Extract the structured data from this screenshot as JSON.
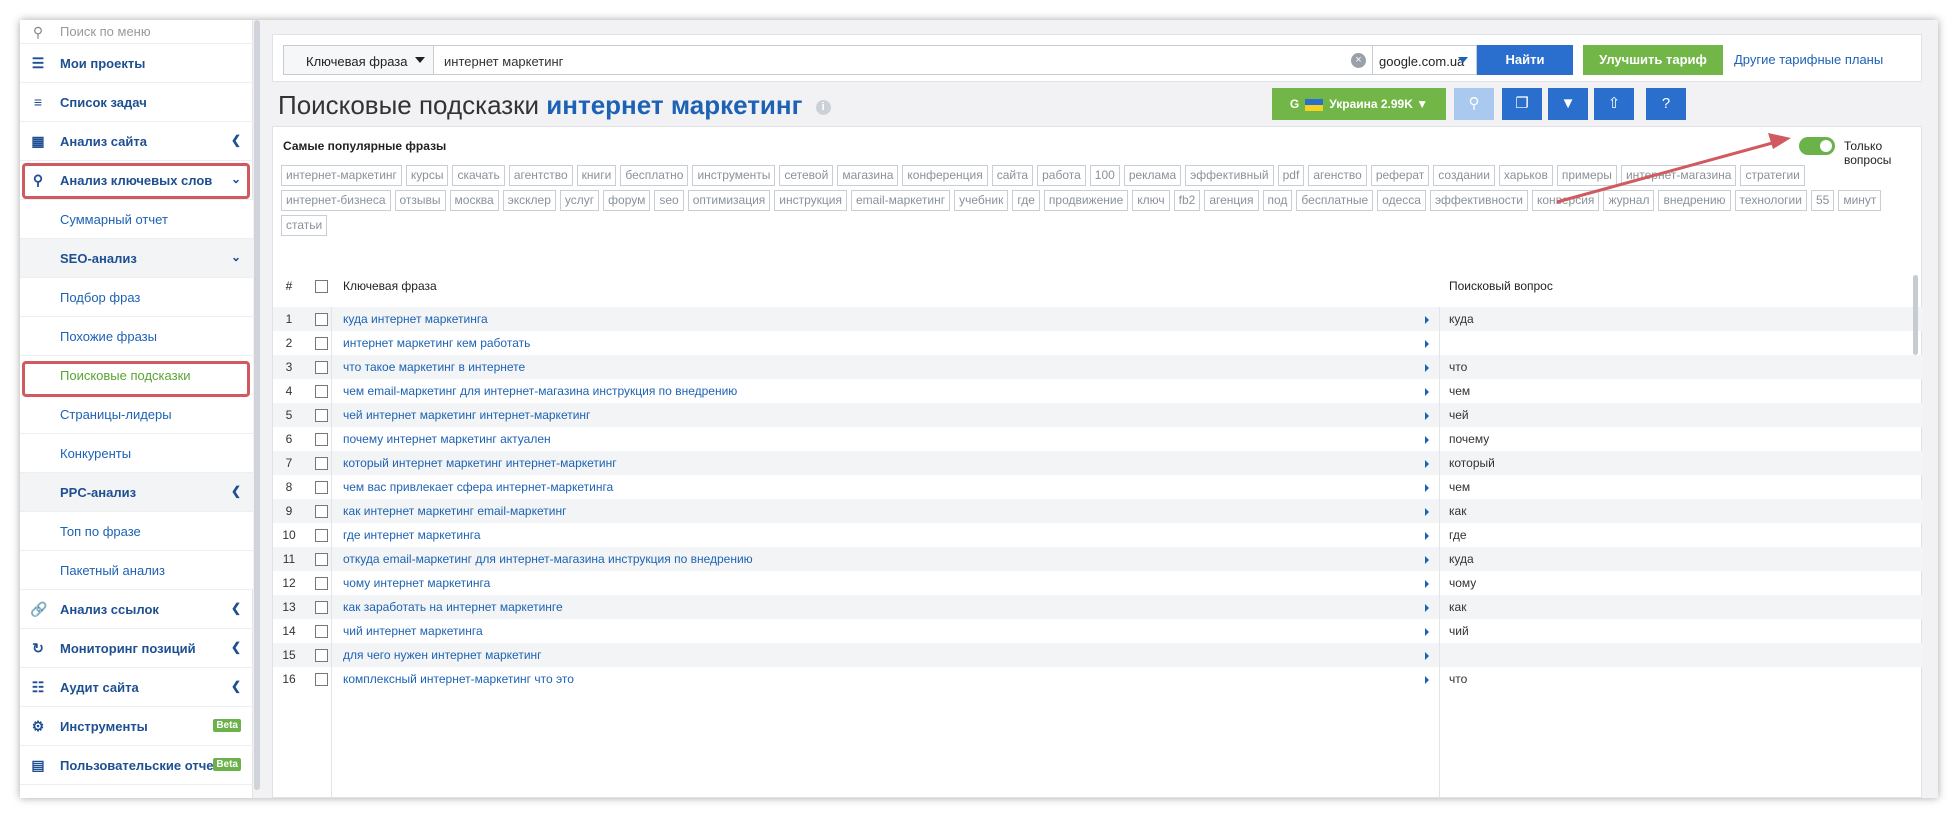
{
  "sidebar": {
    "search_placeholder": "Поиск по меню",
    "items": {
      "projects": "Мои проекты",
      "tasks": "Список задач",
      "site_analysis": "Анализ сайта",
      "keyword_analysis": "Анализ ключевых слов",
      "summary": "Суммарный отчет",
      "seo": "SEO-анализ",
      "phrase_select": "Подбор фраз",
      "similar": "Похожие фразы",
      "suggestions": "Поисковые подсказки",
      "leaders": "Страницы-лидеры",
      "competitors": "Конкуренты",
      "ppc": "PPC-анализ",
      "top_phrase": "Топ по фразе",
      "batch": "Пакетный анализ",
      "links": "Анализ ссылок",
      "monitoring": "Мониторинг позиций",
      "audit": "Аудит сайта",
      "tools": "Инструменты",
      "reports": "Пользовательские отчеты"
    },
    "beta": "Beta"
  },
  "topbar": {
    "mode": "Ключевая фраза",
    "query": "интернет маркетинг",
    "engine": "google.com.ua",
    "find": "Найти",
    "upgrade": "Улучшить тариф",
    "plans": "Другие тарифные планы"
  },
  "header": {
    "title": "Поисковые подсказки",
    "query": "интернет маркетинг",
    "region": "Украина 2.99K",
    "region_letter": "G"
  },
  "popular": {
    "title": "Самые популярные фразы",
    "toggle_label": "Только вопросы",
    "tags": [
      "интернет-маркетинг",
      "курсы",
      "скачать",
      "агентство",
      "книги",
      "бесплатно",
      "инструменты",
      "сетевой",
      "магазина",
      "конференция",
      "сайта",
      "работа",
      "100",
      "реклама",
      "эффективный",
      "pdf",
      "агенство",
      "реферат",
      "создании",
      "харьков",
      "примеры",
      "интернет-магазина",
      "стратегии",
      "интернет-бизнеса",
      "отзывы",
      "москва",
      "эксклер",
      "услуг",
      "форум",
      "seo",
      "оптимизация",
      "инструкция",
      "email-маркетинг",
      "учебник",
      "где",
      "продвижение",
      "ключ",
      "fb2",
      "агенция",
      "под",
      "бесплатные",
      "одесса",
      "эффективности",
      "конверсия",
      "журнал",
      "внедрению",
      "технологии",
      "55",
      "минут",
      "статьи"
    ]
  },
  "table": {
    "col_num": "#",
    "col_kw": "Ключевая фраза",
    "col_q": "Поисковый вопрос",
    "rows": [
      {
        "n": "1",
        "kw": "куда интернет маркетинга",
        "q": "куда"
      },
      {
        "n": "2",
        "kw": "интернет маркетинг кем работать",
        "q": ""
      },
      {
        "n": "3",
        "kw": "что такое маркетинг в интернете",
        "q": "что"
      },
      {
        "n": "4",
        "kw": "чем email-маркетинг для интернет-магазина инструкция по внедрению",
        "q": "чем"
      },
      {
        "n": "5",
        "kw": "чей интернет маркетинг интернет-маркетинг",
        "q": "чей"
      },
      {
        "n": "6",
        "kw": "почему интернет маркетинг актуален",
        "q": "почему"
      },
      {
        "n": "7",
        "kw": "который интернет маркетинг интернет-маркетинг",
        "q": "который"
      },
      {
        "n": "8",
        "kw": "чем вас привлекает сфера интернет-маркетинга",
        "q": "чем"
      },
      {
        "n": "9",
        "kw": "как интернет маркетинг email-маркетинг",
        "q": "как"
      },
      {
        "n": "10",
        "kw": "где интернет маркетинга",
        "q": "где"
      },
      {
        "n": "11",
        "kw": "откуда email-маркетинг для интернет-магазина инструкция по внедрению",
        "q": "куда"
      },
      {
        "n": "12",
        "kw": "чому интернет маркетинга",
        "q": "чому"
      },
      {
        "n": "13",
        "kw": "как заработать на интернет маркетинге",
        "q": "как"
      },
      {
        "n": "14",
        "kw": "чий интернет маркетинга",
        "q": "чий"
      },
      {
        "n": "15",
        "kw": "для чего нужен интернет маркетинг",
        "q": ""
      },
      {
        "n": "16",
        "kw": "комплексный интернет-маркетинг что это",
        "q": "что"
      }
    ]
  },
  "colors": {
    "accent": "#1d62b4",
    "green": "#72b648",
    "highlight": "#d05a60"
  }
}
